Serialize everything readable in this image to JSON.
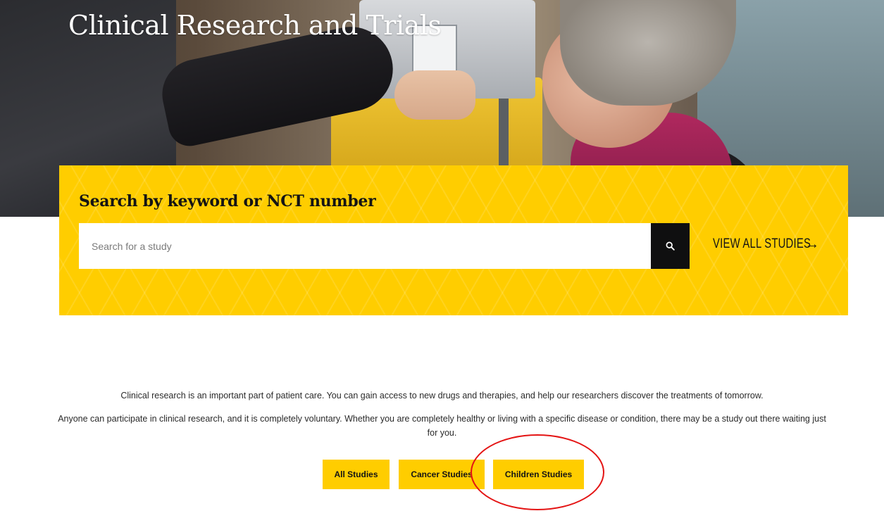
{
  "hero": {
    "title": "Clinical Research and Trials"
  },
  "search": {
    "heading": "Search by keyword or NCT number",
    "placeholder": "Search for a study",
    "value": "",
    "view_all_label": "VIEW ALL STUDIES"
  },
  "intro": {
    "paragraph_1": "Clinical research is an important part of patient care. You can gain access to new drugs and therapies, and help our researchers discover the treatments of tomorrow.",
    "paragraph_2": "Anyone can participate in clinical research, and it is completely voluntary. Whether you are completely healthy or living with a specific disease or condition, there may be a study out there waiting just for you."
  },
  "study_buttons": {
    "all": "All Studies",
    "cancer": "Cancer Studies",
    "children": "Children Studies"
  },
  "icons": {
    "search": "search-icon",
    "arrow": "arrow-right-icon"
  },
  "colors": {
    "accent_yellow": "#ffcd00",
    "dark": "#0f0f10",
    "annotation_red": "#e41414"
  }
}
